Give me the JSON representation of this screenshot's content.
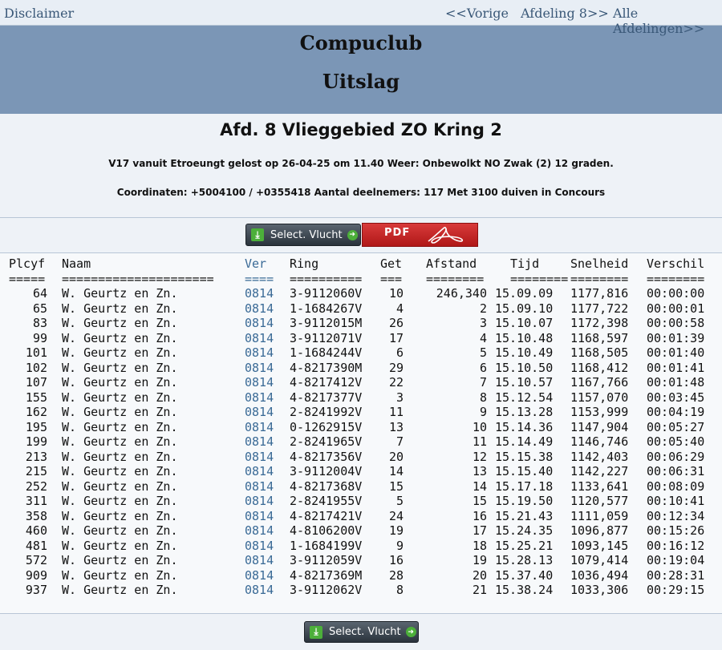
{
  "nav": {
    "disclaimer": "Disclaimer",
    "vorige": "<<Vorige",
    "afdeling8": "Afdeling 8>>",
    "alle": "Alle Afdelingen>>"
  },
  "header": {
    "club": "Compuclub",
    "subtitle": "Uitslag"
  },
  "info": {
    "afdeling": "Afd. 8 Vlieggebied ZO Kring 2",
    "flight": "V17 vanuit Etroeungt gelost op 26-04-25 om 11.40 Weer: Onbewolkt NO Zwak (2) 12 graden.",
    "coords": "Coordinaten: +5004100 / +0355418 Aantal deelnemers: 117 Met 3100 duiven in Concours"
  },
  "buttons": {
    "select_flight": "Select. Vlucht",
    "pdf": "PDF"
  },
  "table": {
    "headers": [
      "Plcyf",
      "Naam",
      "Ver",
      "Ring",
      "Get",
      "Afstand",
      "Tijd",
      "Snelheid",
      "Verschil"
    ],
    "underlines": [
      "=====",
      "=====================",
      "====",
      "==========",
      "===",
      "========",
      "========",
      "========",
      "========"
    ],
    "rows": [
      [
        "64",
        "W. Geurtz en Zn.",
        "0814",
        "3-9112060V",
        "10",
        "246,340",
        "15.09.09",
        "1177,816",
        "00:00:00"
      ],
      [
        "65",
        "W. Geurtz en Zn.",
        "0814",
        "1-1684267V",
        "4",
        "2",
        "15.09.10",
        "1177,722",
        "00:00:01"
      ],
      [
        "83",
        "W. Geurtz en Zn.",
        "0814",
        "3-9112015M",
        "26",
        "3",
        "15.10.07",
        "1172,398",
        "00:00:58"
      ],
      [
        "99",
        "W. Geurtz en Zn.",
        "0814",
        "3-9112071V",
        "17",
        "4",
        "15.10.48",
        "1168,597",
        "00:01:39"
      ],
      [
        "101",
        "W. Geurtz en Zn.",
        "0814",
        "1-1684244V",
        "6",
        "5",
        "15.10.49",
        "1168,505",
        "00:01:40"
      ],
      [
        "102",
        "W. Geurtz en Zn.",
        "0814",
        "4-8217390M",
        "29",
        "6",
        "15.10.50",
        "1168,412",
        "00:01:41"
      ],
      [
        "107",
        "W. Geurtz en Zn.",
        "0814",
        "4-8217412V",
        "22",
        "7",
        "15.10.57",
        "1167,766",
        "00:01:48"
      ],
      [
        "155",
        "W. Geurtz en Zn.",
        "0814",
        "4-8217377V",
        "3",
        "8",
        "15.12.54",
        "1157,070",
        "00:03:45"
      ],
      [
        "162",
        "W. Geurtz en Zn.",
        "0814",
        "2-8241992V",
        "11",
        "9",
        "15.13.28",
        "1153,999",
        "00:04:19"
      ],
      [
        "195",
        "W. Geurtz en Zn.",
        "0814",
        "0-1262915V",
        "13",
        "10",
        "15.14.36",
        "1147,904",
        "00:05:27"
      ],
      [
        "199",
        "W. Geurtz en Zn.",
        "0814",
        "2-8241965V",
        "7",
        "11",
        "15.14.49",
        "1146,746",
        "00:05:40"
      ],
      [
        "213",
        "W. Geurtz en Zn.",
        "0814",
        "4-8217356V",
        "20",
        "12",
        "15.15.38",
        "1142,403",
        "00:06:29"
      ],
      [
        "215",
        "W. Geurtz en Zn.",
        "0814",
        "3-9112004V",
        "14",
        "13",
        "15.15.40",
        "1142,227",
        "00:06:31"
      ],
      [
        "252",
        "W. Geurtz en Zn.",
        "0814",
        "4-8217368V",
        "15",
        "14",
        "15.17.18",
        "1133,641",
        "00:08:09"
      ],
      [
        "311",
        "W. Geurtz en Zn.",
        "0814",
        "2-8241955V",
        "5",
        "15",
        "15.19.50",
        "1120,577",
        "00:10:41"
      ],
      [
        "358",
        "W. Geurtz en Zn.",
        "0814",
        "4-8217421V",
        "24",
        "16",
        "15.21.43",
        "1111,059",
        "00:12:34"
      ],
      [
        "460",
        "W. Geurtz en Zn.",
        "0814",
        "4-8106200V",
        "19",
        "17",
        "15.24.35",
        "1096,877",
        "00:15:26"
      ],
      [
        "481",
        "W. Geurtz en Zn.",
        "0814",
        "1-1684199V",
        "9",
        "18",
        "15.25.21",
        "1093,145",
        "00:16:12"
      ],
      [
        "572",
        "W. Geurtz en Zn.",
        "0814",
        "3-9112059V",
        "16",
        "19",
        "15.28.13",
        "1079,414",
        "00:19:04"
      ],
      [
        "909",
        "W. Geurtz en Zn.",
        "0814",
        "4-8217369M",
        "28",
        "20",
        "15.37.40",
        "1036,494",
        "00:28:31"
      ],
      [
        "937",
        "W. Geurtz en Zn.",
        "0814",
        "3-9112062V",
        "8",
        "21",
        "15.38.24",
        "1033,306",
        "00:29:15"
      ]
    ]
  }
}
